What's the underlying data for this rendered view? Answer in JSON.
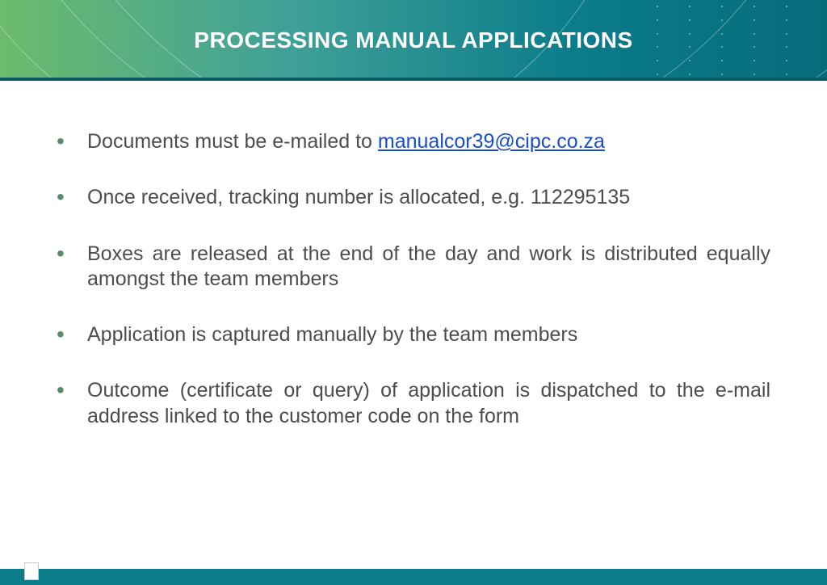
{
  "title": "PROCESSING MANUAL APPLICATIONS",
  "bullets": {
    "b0_pre": "Documents must be e-mailed to ",
    "b0_link": "manualcor39@cipc.co.za",
    "b1": "Once received, tracking number is allocated, e.g. 112295135",
    "b2": "Boxes are released at the end of the day and work is distributed equally amongst the team members",
    "b3": "Application is captured manually by the team members",
    "b4": "Outcome (certificate or query) of application is dispatched to the e-mail address linked to the customer code on the form"
  },
  "email_href": "mailto:manualcor39@cipc.co.za"
}
